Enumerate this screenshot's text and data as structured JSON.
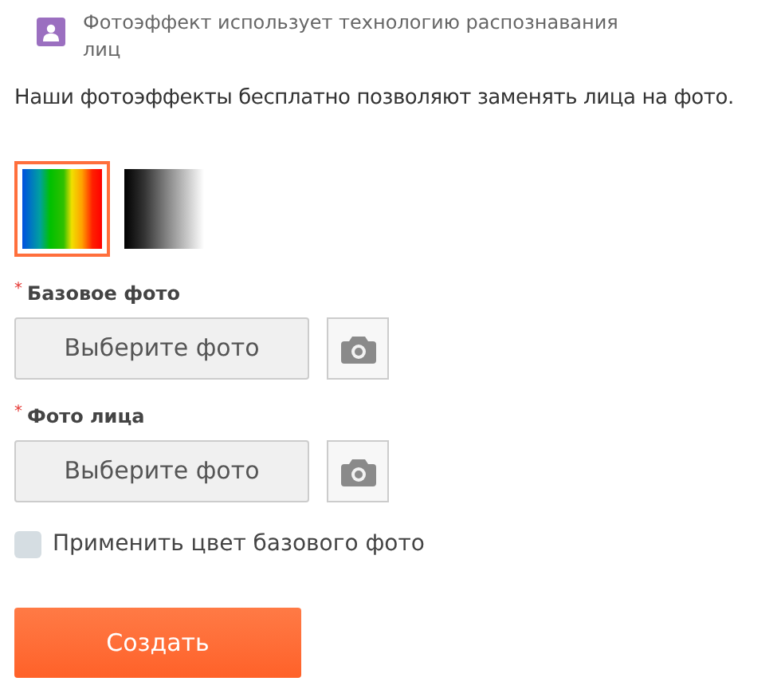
{
  "notice": {
    "text": "Фотоэффект использует технологию распознавания лиц"
  },
  "description": "Наши фотоэффекты бесплатно позволяют заменять лица на фото.",
  "palettes": [
    {
      "kind": "spectrum",
      "selected": true
    },
    {
      "kind": "grayscale",
      "selected": false
    }
  ],
  "uploads": [
    {
      "marker": "*",
      "label": "Базовое фото",
      "button": "Выберите фото"
    },
    {
      "marker": "*",
      "label": "Фото лица",
      "button": "Выберите фото"
    }
  ],
  "option": {
    "label": "Применить цвет базового фото",
    "checked": false
  },
  "submit": "Создать"
}
